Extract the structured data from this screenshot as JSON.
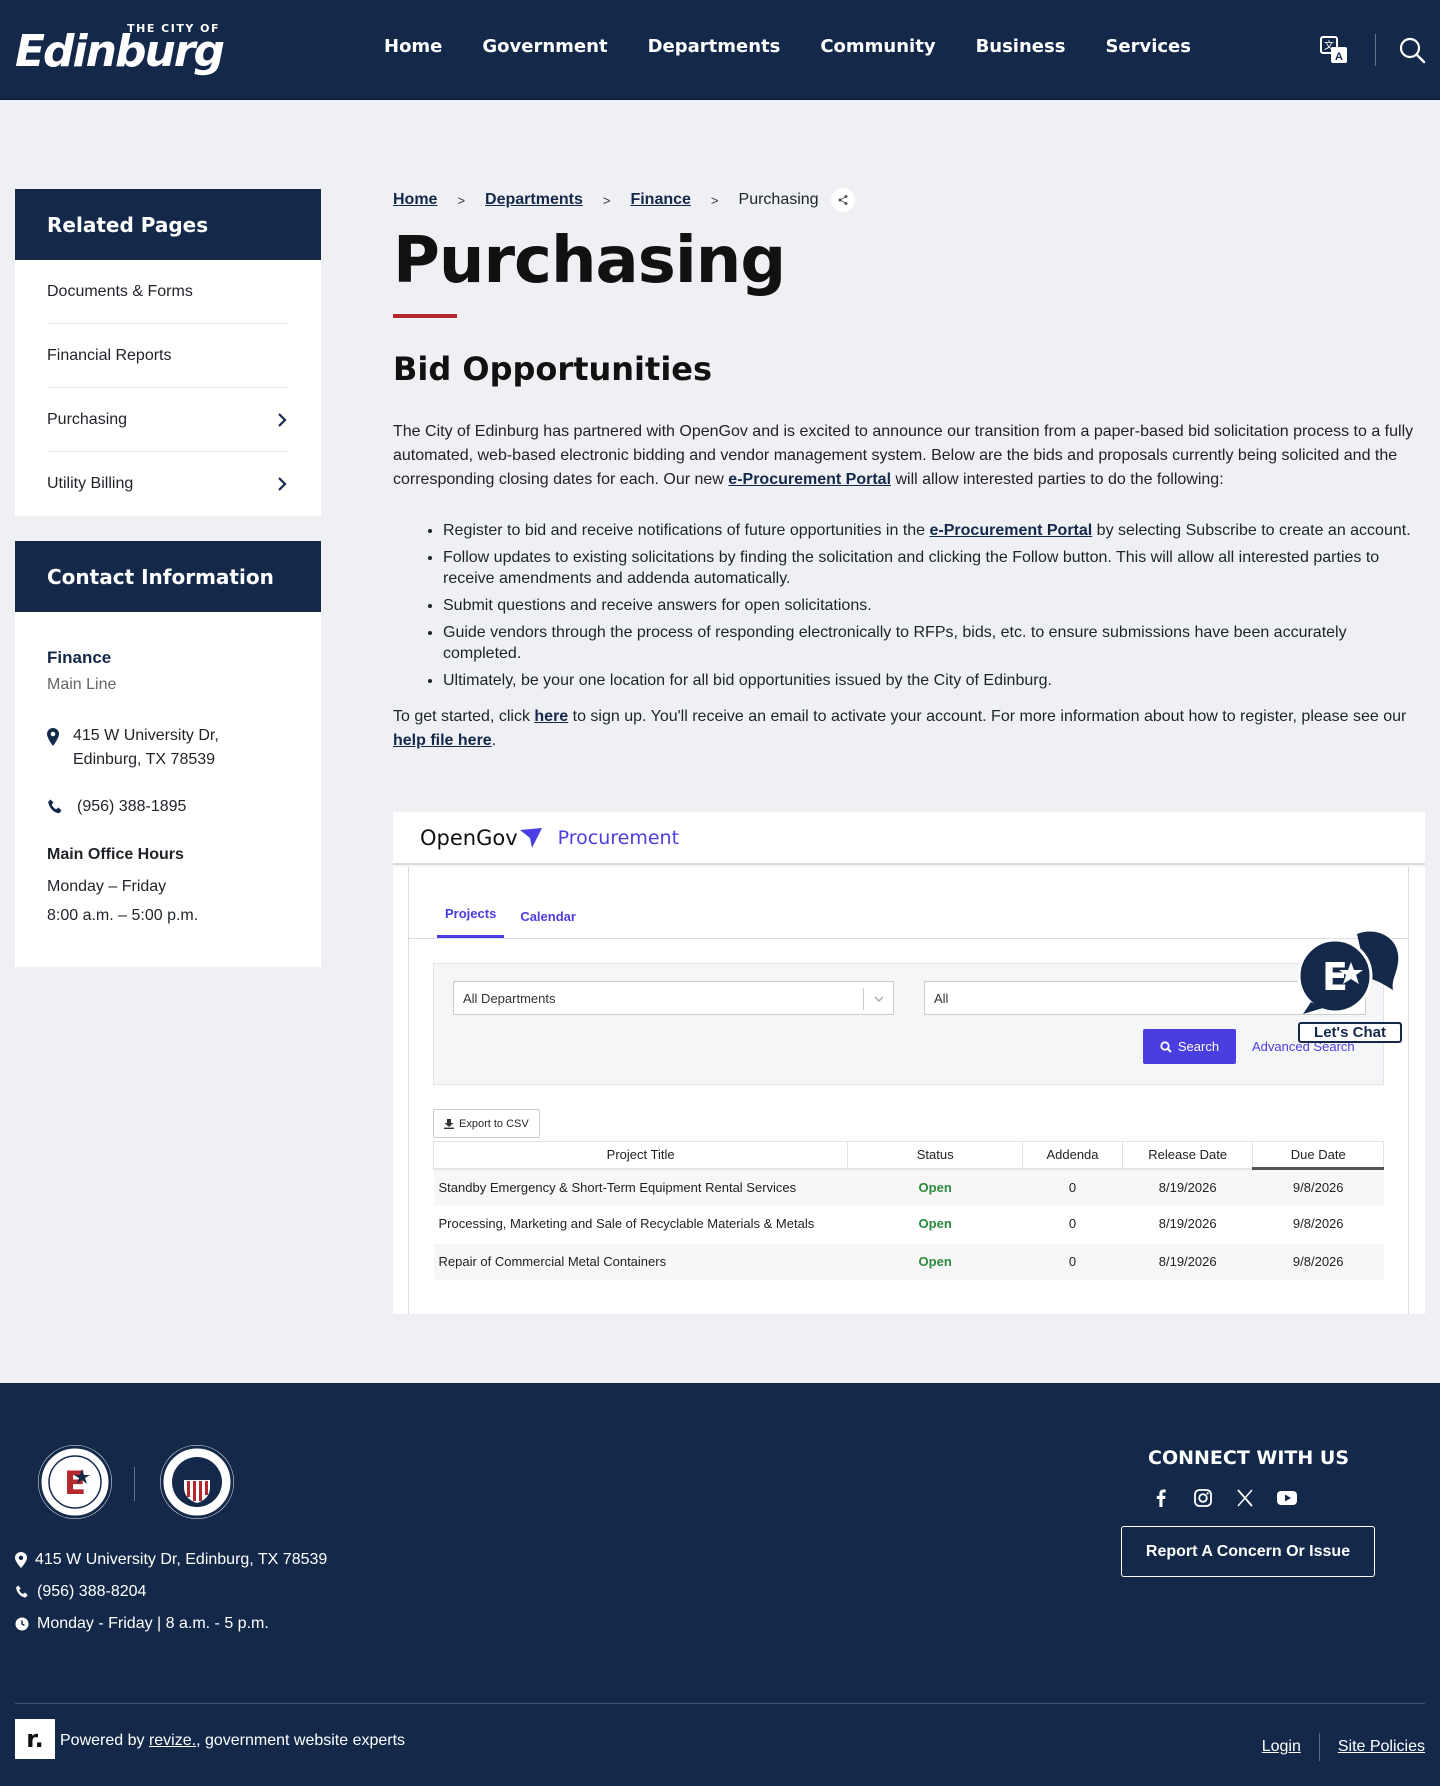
{
  "header": {
    "logo_small": "THE CITY OF",
    "logo_big": "Edinburg",
    "nav": [
      "Home",
      "Government",
      "Departments",
      "Community",
      "Business",
      "Services"
    ],
    "icons": [
      "translate-icon",
      "search-icon"
    ]
  },
  "sidebar": {
    "related_title": "Related Pages",
    "related_items": [
      {
        "label": "Documents & Forms",
        "has_children": false
      },
      {
        "label": "Financial Reports",
        "has_children": false
      },
      {
        "label": "Purchasing",
        "has_children": true
      },
      {
        "label": "Utility Billing",
        "has_children": true
      }
    ],
    "contact_title": "Contact Information",
    "contact": {
      "dept": "Finance",
      "line": "Main Line",
      "address1": "415 W University Dr,",
      "address2": "Edinburg, TX 78539",
      "phone": "(956) 388-1895",
      "hours_title": "Main Office Hours",
      "hours_days": "Monday – Friday",
      "hours_time": "8:00 a.m. – 5:00 p.m."
    }
  },
  "breadcrumb": {
    "items": [
      "Home",
      "Departments",
      "Finance"
    ],
    "current": "Purchasing",
    "separator": ">"
  },
  "page": {
    "title": "Purchasing",
    "subtitle": "Bid Opportunities",
    "intro_before": "The City of Edinburg has partnered with OpenGov and is excited to announce our transition from a paper-based bid solicitation process to a fully automated, web-based electronic bidding and vendor management system. Below are the bids and proposals currently being solicited and the corresponding closing dates for each. Our new ",
    "intro_link": "e-Procurement Portal",
    "intro_after": " will allow interested parties to do the following:",
    "bullet1_before": "Register to bid and receive notifications of future opportunities in the ",
    "bullet1_link": "e-Procurement Portal",
    "bullet1_after": " by selecting Subscribe to create an account.",
    "bullets": [
      "Follow updates to existing solicitations by finding the solicitation and clicking the Follow button. This will allow all interested parties to receive amendments and addenda automatically.",
      "Submit questions and receive answers for open solicitations.",
      "Guide vendors through the process of responding electronically to RFPs, bids, etc. to ensure submissions have been accurately completed.",
      "Ultimately, be your one location for all bid opportunities issued by the City of Edinburg."
    ],
    "start_1": "To get started, click ",
    "start_link1": "here",
    "start_2": " to sign up. You'll receive an email to activate your account. For more information about how to register, please see our ",
    "start_link2": "help file here",
    "start_3": "."
  },
  "opengov": {
    "brand": "OpenGov",
    "product": "Procurement",
    "tabs": [
      "Projects",
      "Calendar"
    ],
    "department_select": "All Departments",
    "status_select": "All",
    "search_label": "Search",
    "advanced_label": "Advanced Search",
    "export_label": "Export to CSV",
    "columns": [
      "Project Title",
      "Status",
      "Addenda",
      "Release Date",
      "Due Date"
    ],
    "rows": [
      {
        "title": "Standby Emergency & Short-Term Equipment Rental Services",
        "status": "Open",
        "addenda": "0",
        "release": "8/19/2026",
        "due": "9/8/2026"
      },
      {
        "title": "Processing, Marketing and Sale of Recyclable Materials & Metals",
        "status": "Open",
        "addenda": "0",
        "release": "8/19/2026",
        "due": "9/8/2026"
      },
      {
        "title": "Repair of Commercial Metal Containers",
        "status": "Open",
        "addenda": "0",
        "release": "8/19/2026",
        "due": "9/8/2026"
      }
    ]
  },
  "chat": {
    "label": "Let's Chat"
  },
  "footer": {
    "address": "415 W University Dr, Edinburg, TX 78539",
    "phone": "(956) 388-8204",
    "hours": "Monday - Friday | 8 a.m. - 5 p.m.",
    "connect_title": "CONNECT WITH US",
    "socials": [
      "facebook-icon",
      "instagram-icon",
      "x-icon",
      "youtube-icon"
    ],
    "report_button": "Report A Concern Or Issue",
    "revize_letter": "r.",
    "powered_before": "Powered by ",
    "powered_link": "revize.",
    "powered_after": ", government website experts",
    "links": [
      "Login",
      "Site Policies"
    ]
  },
  "colors": {
    "navy": "#14294a",
    "accent_red": "#b3272d",
    "opengov_purple": "#4b3ee0",
    "status_green": "#2b8a3e"
  }
}
